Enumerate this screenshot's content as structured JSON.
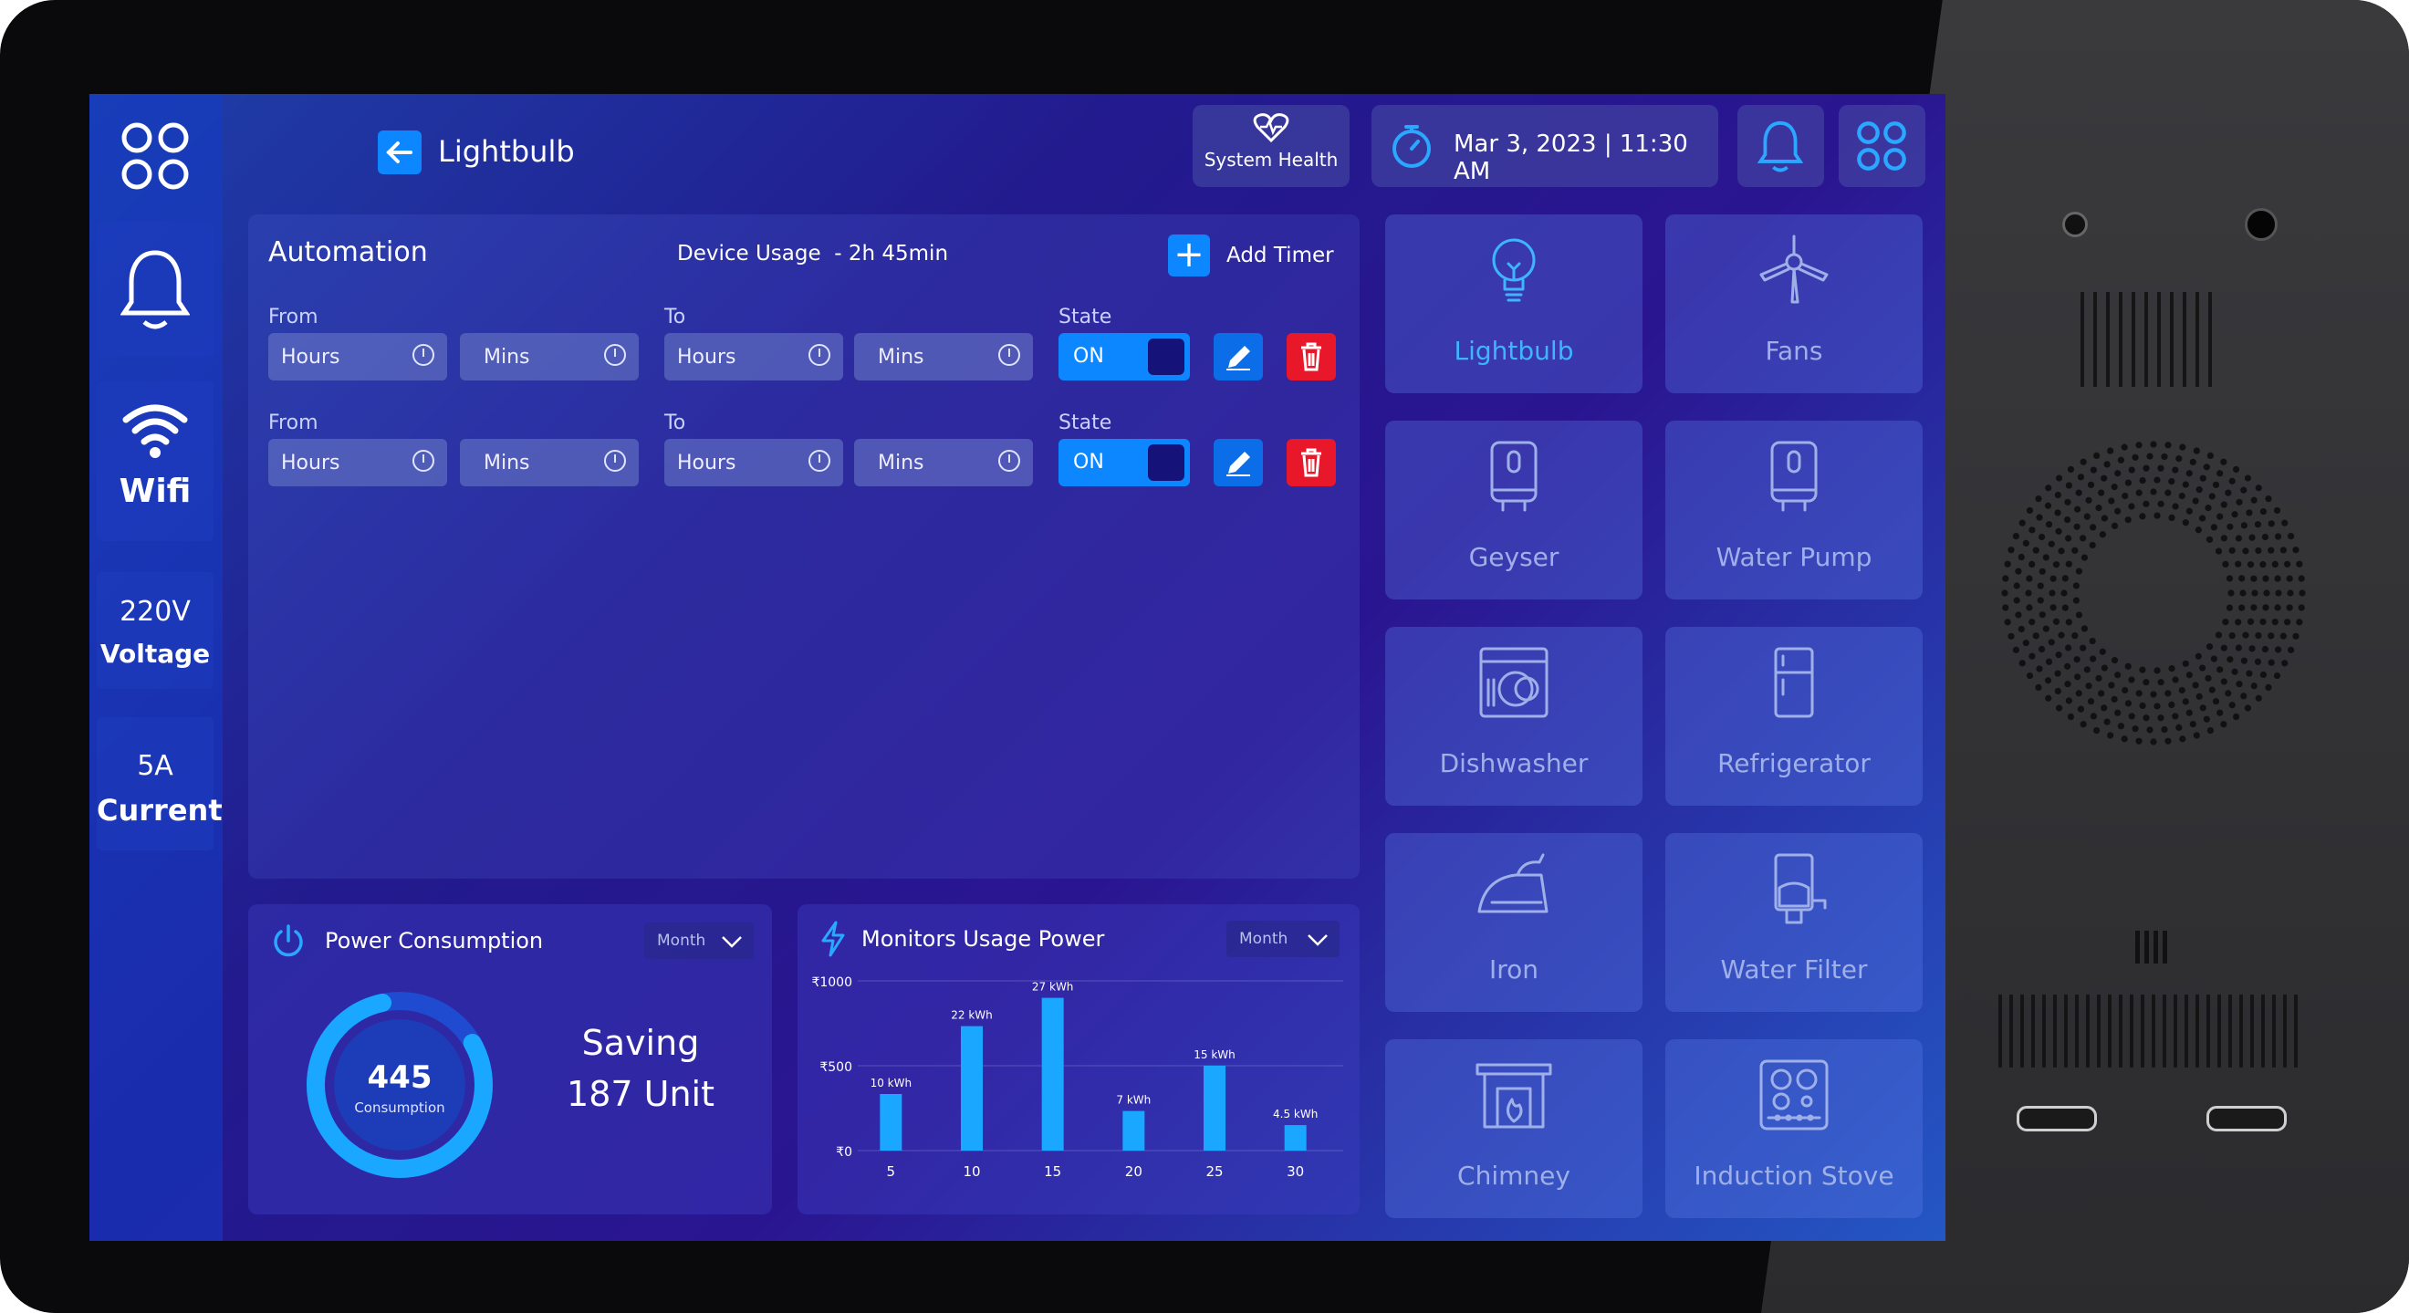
{
  "header": {
    "back_title": "Lightbulb",
    "system_health": "System Health",
    "datetime": "Mar 3, 2023 | 11:30 AM"
  },
  "sidebar": {
    "wifi": "Wifi",
    "voltage_value": "220V",
    "voltage_label": "Voltage",
    "current_value": "5A",
    "current_label": "Current"
  },
  "automation": {
    "title": "Automation",
    "device_usage": "Device Usage  - 2h 45min",
    "add_timer": "Add Timer",
    "rows": [
      {
        "from_label": "From",
        "to_label": "To",
        "state_label": "State",
        "from_hours": "Hours",
        "from_mins": "Mins",
        "to_hours": "Hours",
        "to_mins": "Mins",
        "state": "ON"
      },
      {
        "from_label": "From",
        "to_label": "To",
        "state_label": "State",
        "from_hours": "Hours",
        "from_mins": "Mins",
        "to_hours": "Hours",
        "to_mins": "Mins",
        "state": "ON"
      }
    ]
  },
  "power": {
    "title": "Power Consumption",
    "period": "Month",
    "value": "445",
    "value_label": "Consumption",
    "ring_fraction": 0.8,
    "saving_line1": "Saving",
    "saving_line2": "187 Unit"
  },
  "monitor": {
    "title": "Monitors Usage Power",
    "period": "Month"
  },
  "chart_data": {
    "type": "bar",
    "categories": [
      "5",
      "10",
      "15",
      "20",
      "25",
      "30"
    ],
    "values": [
      10,
      22,
      27,
      7,
      15,
      4.5
    ],
    "data_labels": [
      "10 kWh",
      "22 kWh",
      "27 kWh",
      "7 kWh",
      "15 kWh",
      "4.5 kWh"
    ],
    "y_ticks": [
      "₹1000",
      "₹500",
      "₹0"
    ],
    "ylim": [
      0,
      30
    ],
    "grid": true
  },
  "devices": [
    {
      "label": "Lightbulb",
      "icon": "lightbulb-icon",
      "active": true
    },
    {
      "label": "Fans",
      "icon": "ceiling-fan-icon",
      "active": false
    },
    {
      "label": "Geyser",
      "icon": "geyser-icon",
      "active": false
    },
    {
      "label": "Water Pump",
      "icon": "water-pump-icon",
      "active": false
    },
    {
      "label": "Dishwasher",
      "icon": "dishwasher-icon",
      "active": false
    },
    {
      "label": "Refrigerator",
      "icon": "refrigerator-icon",
      "active": false
    },
    {
      "label": "Iron",
      "icon": "iron-icon",
      "active": false
    },
    {
      "label": "Water Filter",
      "icon": "water-filter-icon",
      "active": false
    },
    {
      "label": "Chimney",
      "icon": "chimney-icon",
      "active": false
    },
    {
      "label": "Induction Stove",
      "icon": "induction-stove-icon",
      "active": false
    }
  ],
  "colors": {
    "accent": "#0c87ff",
    "active_label": "#3fb4ff",
    "delete": "#e8182a"
  }
}
